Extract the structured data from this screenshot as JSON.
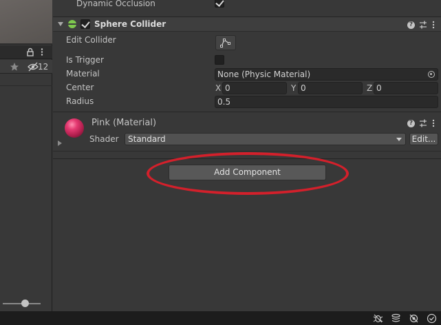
{
  "left_panel": {
    "hidden_count": "12"
  },
  "inspector": {
    "dynamic_occlusion": {
      "label": "Dynamic Occlusion",
      "checked": true
    },
    "sphere_collider": {
      "title": "Sphere Collider",
      "enabled": true,
      "edit_collider_label": "Edit Collider",
      "is_trigger_label": "Is Trigger",
      "is_trigger_checked": false,
      "material_label": "Material",
      "material_value": "None (Physic Material)",
      "center_label": "Center",
      "center": {
        "x_label": "X",
        "x": "0",
        "y_label": "Y",
        "y": "0",
        "z_label": "Z",
        "z": "0"
      },
      "radius_label": "Radius",
      "radius_value": "0.5"
    },
    "material": {
      "title": "Pink (Material)",
      "shader_label": "Shader",
      "shader_value": "Standard",
      "edit_label": "Edit..."
    },
    "add_component_label": "Add Component"
  },
  "colors": {
    "highlight_ellipse": "#d3202b",
    "collider_icon": "#7ec84e",
    "material_ball": "#c42459"
  }
}
